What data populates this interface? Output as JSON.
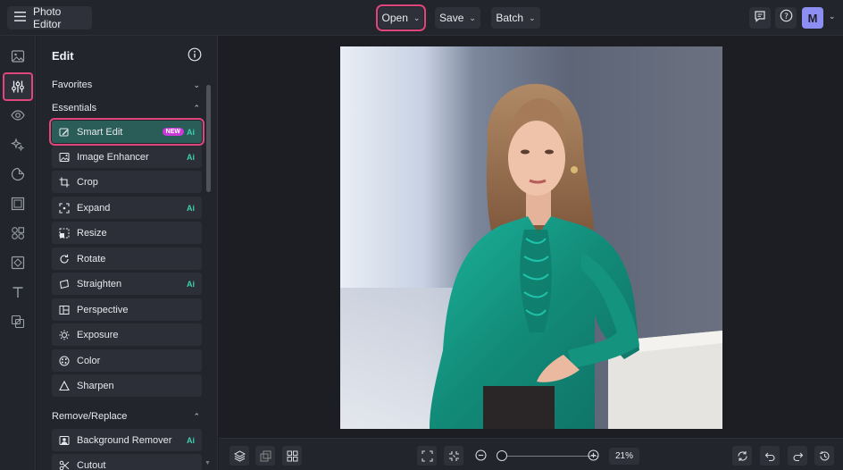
{
  "topbar": {
    "app_title": "Photo Editor",
    "open_label": "Open",
    "save_label": "Save",
    "batch_label": "Batch",
    "avatar_letter": "M"
  },
  "rail": {
    "icons": [
      "image-icon",
      "sliders-icon",
      "eye-icon",
      "sparkle-icon",
      "sticker-icon",
      "frame-icon",
      "shapes-icon",
      "texture-icon",
      "text-icon",
      "layers-overlay-icon"
    ],
    "active": "sliders-icon"
  },
  "panel": {
    "title": "Edit",
    "sections": {
      "favorites": "Favorites",
      "essentials": "Essentials",
      "remove_replace": "Remove/Replace"
    },
    "tools": [
      {
        "label": "Smart Edit",
        "badge_new": "NEW",
        "ai": "Ai",
        "icon": "smart-edit-icon"
      },
      {
        "label": "Image Enhancer",
        "ai": "Ai",
        "icon": "image-enhancer-icon"
      },
      {
        "label": "Crop",
        "icon": "crop-icon"
      },
      {
        "label": "Expand",
        "ai": "Ai",
        "icon": "expand-icon"
      },
      {
        "label": "Resize",
        "icon": "resize-icon"
      },
      {
        "label": "Rotate",
        "icon": "rotate-icon"
      },
      {
        "label": "Straighten",
        "ai": "Ai",
        "icon": "straighten-icon"
      },
      {
        "label": "Perspective",
        "icon": "perspective-icon"
      },
      {
        "label": "Exposure",
        "icon": "exposure-icon"
      },
      {
        "label": "Color",
        "icon": "color-icon"
      },
      {
        "label": "Sharpen",
        "icon": "sharpen-icon"
      }
    ],
    "remove_tools": [
      {
        "label": "Background Remover",
        "ai": "Ai",
        "icon": "background-remover-icon"
      },
      {
        "label": "Cutout",
        "icon": "cutout-icon"
      }
    ]
  },
  "bottombar": {
    "zoom": "21%"
  },
  "colors": {
    "highlight": "#e0457b",
    "accent_ai": "#3ecfb0",
    "active_tool": "#2a5d57",
    "photo_shirt": "#169a86"
  }
}
